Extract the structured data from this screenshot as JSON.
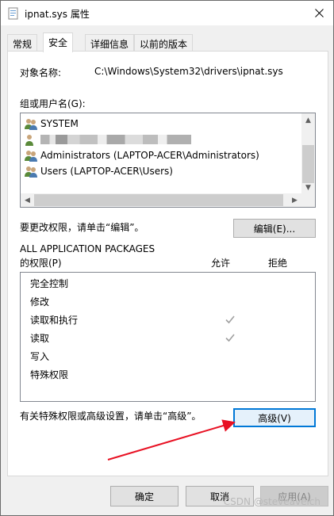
{
  "window": {
    "title": "ipnat.sys 属性"
  },
  "tabs": [
    {
      "label": "常规"
    },
    {
      "label": "安全"
    },
    {
      "label": "详细信息"
    },
    {
      "label": "以前的版本"
    }
  ],
  "object_name": {
    "label": "对象名称:",
    "value": "C:\\Windows\\System32\\drivers\\ipnat.sys"
  },
  "groups": {
    "label": "组或用户名(G):",
    "items": [
      {
        "label": "SYSTEM"
      },
      {
        "label": ""
      },
      {
        "label": "Administrators (LAPTOP-ACER\\Administrators)"
      },
      {
        "label": "Users (LAPTOP-ACER\\Users)"
      }
    ]
  },
  "edit": {
    "hint": "要更改权限，请单击“编辑”。",
    "button": "编辑(E)..."
  },
  "permissions": {
    "principal": "ALL APPLICATION PACKAGES",
    "label": "的权限(P)",
    "allow_col": "允许",
    "deny_col": "拒绝",
    "rows": [
      {
        "name": "完全控制",
        "allow": false
      },
      {
        "name": "修改",
        "allow": false
      },
      {
        "name": "读取和执行",
        "allow": true
      },
      {
        "name": "读取",
        "allow": true
      },
      {
        "name": "写入",
        "allow": false
      },
      {
        "name": "特殊权限",
        "allow": false
      }
    ]
  },
  "advanced": {
    "hint": "有关特殊权限或高级设置，请单击“高级”。",
    "button": "高级(V)"
  },
  "footer": {
    "ok": "确定",
    "cancel": "取消",
    "apply": "应用(A)"
  },
  "watermark": "CSDN @steveaveich",
  "colors": {
    "accent": "#0078d7",
    "arrow": "#e81123"
  }
}
